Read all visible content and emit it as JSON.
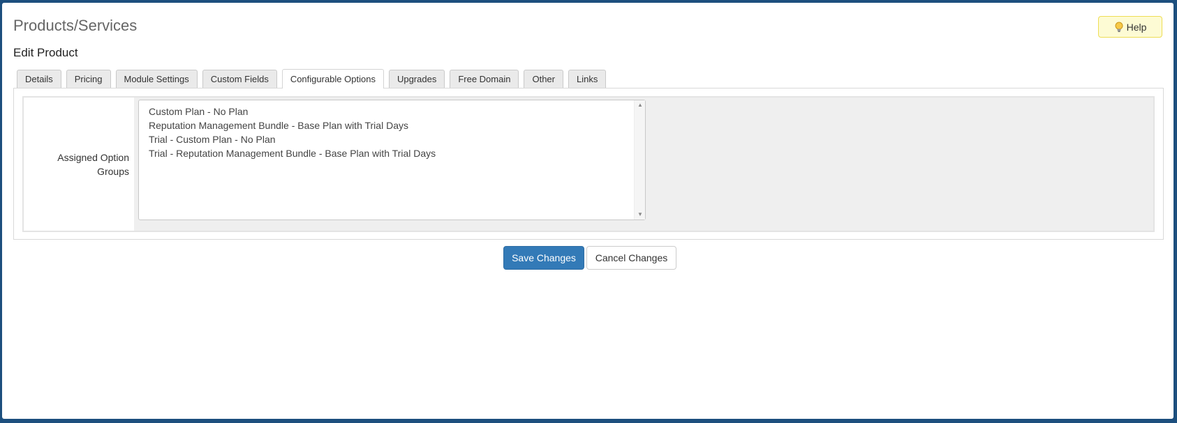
{
  "header": {
    "title": "Products/Services",
    "subtitle": "Edit Product",
    "help_label": "Help"
  },
  "tabs": [
    {
      "label": "Details"
    },
    {
      "label": "Pricing"
    },
    {
      "label": "Module Settings"
    },
    {
      "label": "Custom Fields"
    },
    {
      "label": "Configurable Options",
      "active": true
    },
    {
      "label": "Upgrades"
    },
    {
      "label": "Free Domain"
    },
    {
      "label": "Other"
    },
    {
      "label": "Links"
    }
  ],
  "form": {
    "assigned_label": "Assigned Option Groups",
    "options": [
      "Custom Plan - No Plan",
      "Reputation Management Bundle - Base Plan with Trial Days",
      "Trial - Custom Plan - No Plan",
      "Trial - Reputation Management Bundle - Base Plan with Trial Days"
    ]
  },
  "actions": {
    "save_label": "Save Changes",
    "cancel_label": "Cancel Changes"
  },
  "colors": {
    "background": "#1d4f7e",
    "primary_button": "#337ab7",
    "help_button": "#fdfbd4"
  },
  "icons": {
    "help": "bulb-icon",
    "scroll_up": "triangle-up-icon",
    "scroll_down": "triangle-down-icon"
  }
}
